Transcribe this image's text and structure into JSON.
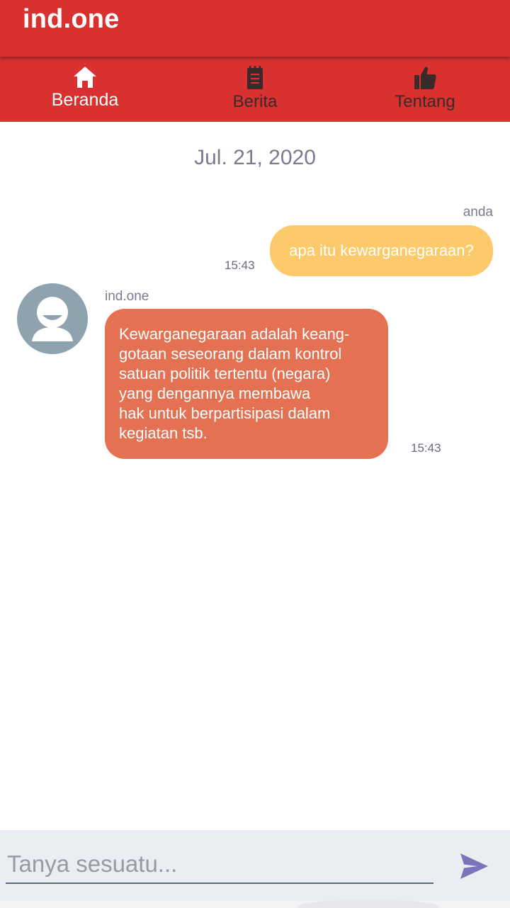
{
  "app": {
    "title": "ind.one",
    "brand_color": "#d93030"
  },
  "tabs": [
    {
      "label": "Beranda",
      "icon": "home-icon",
      "active": true
    },
    {
      "label": "Berita",
      "icon": "notepad-icon",
      "active": false
    },
    {
      "label": "Tentang",
      "icon": "thumbs-up-icon",
      "active": false
    }
  ],
  "chat": {
    "date": "Jul. 21, 2020",
    "messages": [
      {
        "sender": "anda",
        "text": "apa itu kewarganegaraan?",
        "time": "15:43",
        "direction": "outgoing",
        "bubble_color": "#fdca6b"
      },
      {
        "sender": "ind.one",
        "lines": [
          "Kewarganegaraan adalah keang-",
          "gotaan seseorang dalam kontrol",
          "satuan politik tertentu (negara)",
          "yang dengannya membawa",
          "hak untuk berpartisipasi dalam",
          "kegiatan tsb."
        ],
        "time": "15:43",
        "direction": "incoming",
        "avatar_icon": "user-avatar-icon",
        "bubble_color": "#e47152"
      }
    ]
  },
  "composer": {
    "placeholder": "Tanya sesuatu...",
    "value": "",
    "send_icon": "send-icon",
    "send_color": "#7b74b8"
  }
}
